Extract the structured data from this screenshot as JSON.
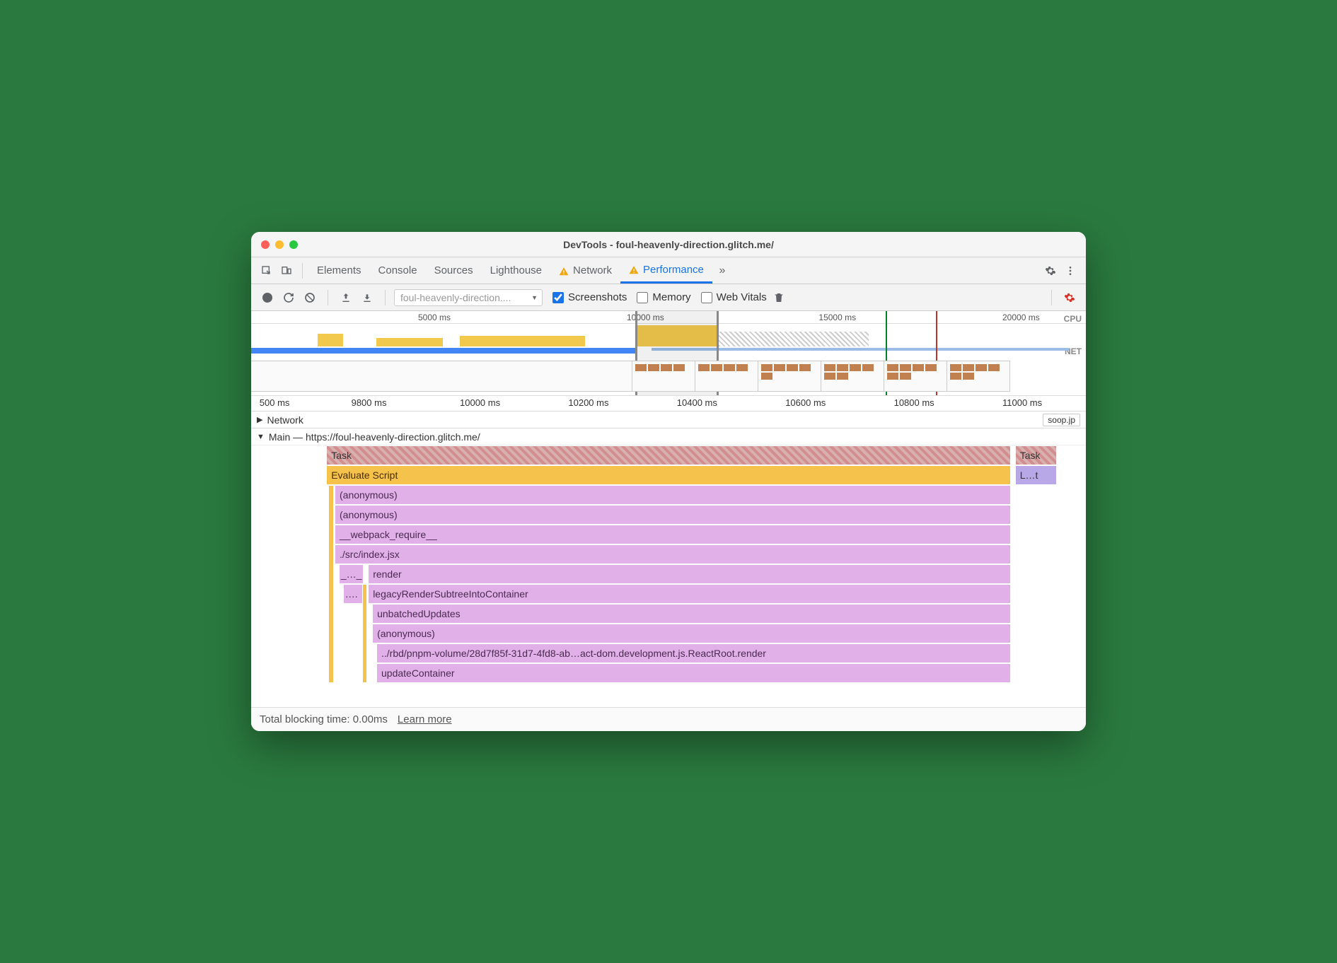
{
  "window_title": "DevTools - foul-heavenly-direction.glitch.me/",
  "tabs": [
    "Elements",
    "Console",
    "Sources",
    "Lighthouse",
    "Network",
    "Performance"
  ],
  "active_tab": "Performance",
  "toolbar": {
    "dropdown": "foul-heavenly-direction....",
    "screenshots": "Screenshots",
    "memory": "Memory",
    "webvitals": "Web Vitals"
  },
  "overview": {
    "ticks": [
      "5000 ms",
      "10000 ms",
      "15000 ms",
      "20000 ms"
    ],
    "cpu_label": "CPU",
    "net_label": "NET"
  },
  "detail_ticks": [
    "500 ms",
    "9800 ms",
    "10000 ms",
    "10200 ms",
    "10400 ms",
    "10600 ms",
    "10800 ms",
    "11000 ms"
  ],
  "network_section": "Network",
  "network_item": "soop.jp",
  "main_title": "Main — https://foul-heavenly-direction.glitch.me/",
  "flame": {
    "task": "Task",
    "task2": "Task",
    "evaluate": "Evaluate Script",
    "layout_short": "L…t",
    "rows": [
      "(anonymous)",
      "(anonymous)",
      "__webpack_require__",
      "./src/index.jsx",
      "render",
      "legacyRenderSubtreeIntoContainer",
      "unbatchedUpdates",
      "(anonymous)",
      "../rbd/pnpm-volume/28d7f85f-31d7-4fd8-ab…act-dom.development.js.ReactRoot.render",
      "updateContainer"
    ],
    "row_prefixes": [
      "",
      "",
      "",
      "",
      "_…_",
      "….",
      "",
      "",
      "",
      ""
    ]
  },
  "footer": {
    "tbt": "Total blocking time: 0.00ms",
    "learn": "Learn more"
  }
}
